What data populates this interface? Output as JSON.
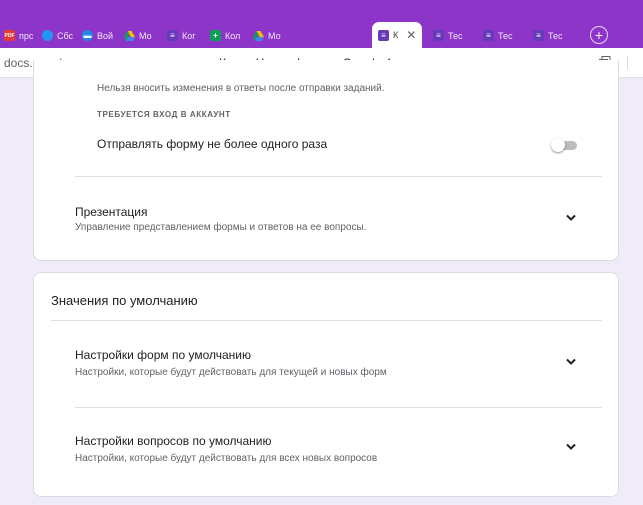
{
  "browser": {
    "tabs": [
      {
        "label": "прс",
        "icon": "pdf-icon",
        "icon_color": "#e53935",
        "icon_char": "PDF"
      },
      {
        "label": "Сбс",
        "icon": "cube-icon",
        "icon_color": "#2196f3",
        "icon_char": ""
      },
      {
        "label": "Вой",
        "icon": "chat-icon",
        "icon_color": "#1e88e5",
        "icon_char": ""
      },
      {
        "label": "Мо",
        "icon": "drive-icon",
        "icon_color": "#fbbc04",
        "icon_char": ""
      },
      {
        "label": "Ког",
        "icon": "forms-icon",
        "icon_color": "#673ab7",
        "icon_char": "≡"
      },
      {
        "label": "Кол",
        "icon": "add-green-icon",
        "icon_color": "#0f9d58",
        "icon_char": "+"
      },
      {
        "label": "Мо",
        "icon": "drive-icon",
        "icon_color": "#fbbc04",
        "icon_char": ""
      },
      {
        "label": "К",
        "icon": "forms-icon",
        "icon_color": "#673ab7",
        "icon_char": "≡",
        "active": true
      },
      {
        "label": "Тес",
        "icon": "forms-icon",
        "icon_color": "#673ab7",
        "icon_char": "≡"
      },
      {
        "label": "Тес",
        "icon": "forms-icon",
        "icon_color": "#673ab7",
        "icon_char": "≡"
      },
      {
        "label": "Тес",
        "icon": "forms-icon",
        "icon_color": "#673ab7",
        "icon_char": "≡"
      }
    ],
    "url": "docs.google.com",
    "page_title": "Копия Новая форма - Google Формы"
  },
  "card1": {
    "clipped_text": "Нельзя вносить изменения в ответы после отправки заданий.",
    "hint": "ТРЕБУЕТСЯ ВХОД В АККАУНТ",
    "option_label": "Отправлять форму не более одного раза",
    "option_enabled": false,
    "presentation": {
      "title": "Презентация",
      "subtitle": "Управление представлением формы и ответов на ее вопросы."
    }
  },
  "card2": {
    "header": "Значения по умолчанию",
    "sections": [
      {
        "title": "Настройки форм по умолчанию",
        "subtitle": "Настройки, которые будут действовать для текущей и новых форм"
      },
      {
        "title": "Настройки вопросов по умолчанию",
        "subtitle": "Настройки, которые будут действовать для всех новых вопросов"
      }
    ]
  },
  "colors": {
    "tab_strip": "#8e35c9",
    "page_background": "#f0ebf8",
    "toggle_off": "#bdbdbd"
  }
}
